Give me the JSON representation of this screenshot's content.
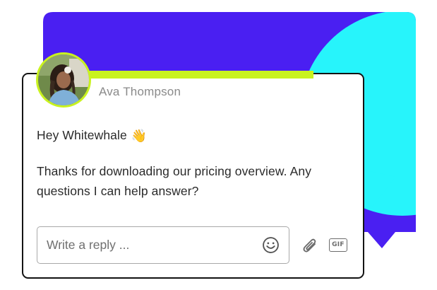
{
  "colors": {
    "backdrop_blue": "#4a1ff2",
    "backdrop_cyan": "#27f4fb",
    "accent_lime": "#c9f21f",
    "card_border": "#141414"
  },
  "sender": {
    "name": "Ava Thompson",
    "avatar": "avatar-photo"
  },
  "message": {
    "greeting": "Hey Whitewhale",
    "greeting_emoji": "👋",
    "line1": "Thanks for downloading our pricing overview. Any",
    "line2": "questions I can help answer?"
  },
  "composer": {
    "placeholder": "Write a reply ...",
    "emoji_icon": "smiley-icon",
    "attach_icon": "paperclip-icon",
    "gif_label": "GIF"
  }
}
